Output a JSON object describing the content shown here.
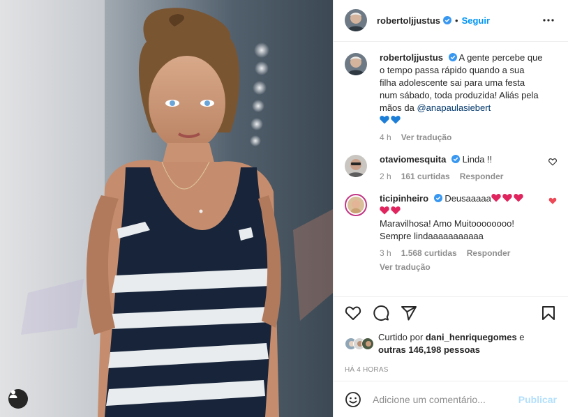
{
  "post": {
    "author": "robertoljjustus",
    "follow_label": "Seguir",
    "dot": "•",
    "caption": {
      "user": "robertoljjustus",
      "text": "A gente percebe que o tempo passa rápido quando a sua filha adolescente sai para uma festa num sábado, toda produzida! Aliás pela mãos da ",
      "mention": "@anapaulasiebert",
      "time": "4 h",
      "translate": "Ver tradução"
    },
    "comments": [
      {
        "user": "otaviomesquita",
        "text": "Linda !!",
        "time": "2 h",
        "likes": "161 curtidas",
        "reply": "Responder",
        "liked": false
      },
      {
        "user": "ticipinheiro",
        "text_a": "Deusaaaaa",
        "text_b": "Maravilhosa! Amo Muitoooooooo! Sempre lindaaaaaaaaaaa",
        "time": "3 h",
        "likes": "1.568 curtidas",
        "reply": "Responder",
        "translate": "Ver tradução",
        "liked": true
      }
    ],
    "liked_by_prefix": "Curtido por ",
    "liked_by_user": "dani_henriquegomes",
    "liked_by_mid": " e ",
    "liked_by_others": "outras 146,198 pessoas",
    "timestamp": "HÁ 4 HORAS",
    "comment_placeholder": "Adicione um comentário...",
    "publish_label": "Publicar"
  },
  "icons": {
    "verified": "verified-badge-icon",
    "more": "more-options-icon",
    "like": "heart-icon",
    "comment": "comment-icon",
    "share": "share-icon",
    "save": "bookmark-icon",
    "emoji": "emoji-icon",
    "user_tag": "user-tag-icon"
  },
  "colors": {
    "accent": "#0095f6",
    "publish_disabled": "#b2dffc",
    "liked_heart": "#ed4956",
    "muted": "#8e8e8e",
    "emoji_heart": "#e0245e",
    "blue_heart": "#1d7ed8"
  }
}
